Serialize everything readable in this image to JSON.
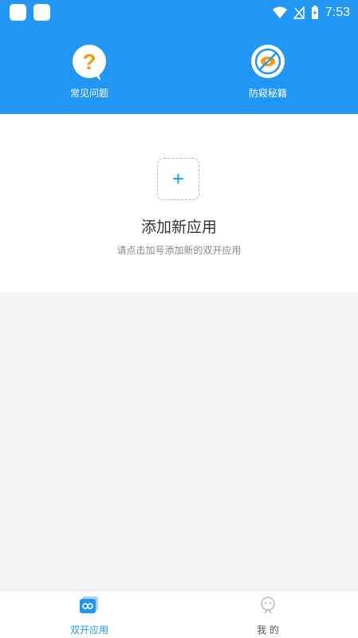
{
  "status": {
    "time": "7:53"
  },
  "header": {
    "shortcuts": [
      {
        "label": "常见问题",
        "icon": "question-icon"
      },
      {
        "label": "防窥秘籍",
        "icon": "eye-slash-icon"
      }
    ]
  },
  "add_card": {
    "plus": "+",
    "title": "添加新应用",
    "subtitle": "请点击加号添加新的双开应用"
  },
  "bottom_nav": {
    "tabs": [
      {
        "label": "双开应用",
        "icon": "dual-app-icon",
        "active": true
      },
      {
        "label": "我 的",
        "icon": "profile-icon",
        "active": false
      }
    ]
  },
  "colors": {
    "primary": "#2196f3",
    "accent": "#f39c12",
    "background": "#f3f3f3"
  }
}
